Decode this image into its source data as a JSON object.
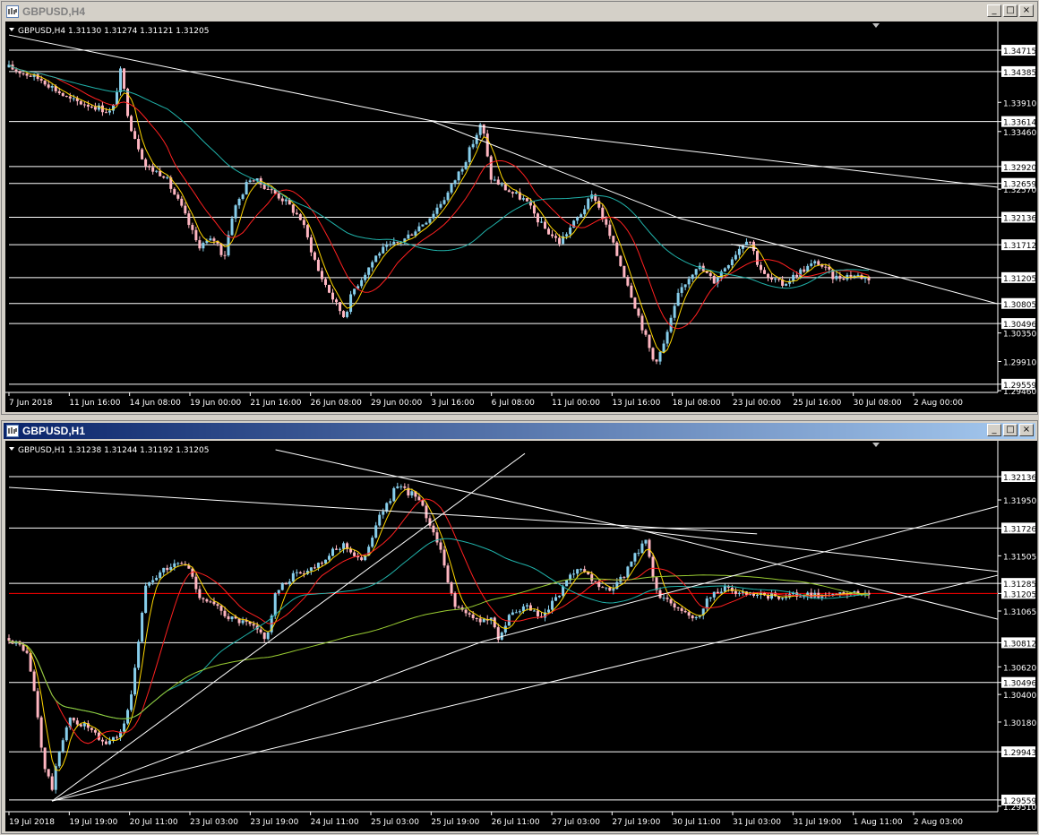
{
  "colors": {
    "background": "#000000",
    "bull_candle": "#87ceeb",
    "bear_candle": "#ffb6c1",
    "ma_fast": "#ffd700",
    "ma_mid": "#ff2020",
    "ma_slow": "#20b2aa",
    "ma_slowest": "#9acd32",
    "hline": "#ffffff",
    "text": "#ffffff",
    "current_price": "#ff0000"
  },
  "windows": [
    {
      "title": "GBPUSD,H4",
      "state": "inactive",
      "info": "GBPUSD,H4  1.31130 1.31274 1.31121 1.31205",
      "price_range": [
        1.2946,
        1.3502
      ],
      "price_ticks": [
        "1.34715",
        "1.34385",
        "1.33910",
        "1.33614",
        "1.33460",
        "1.32920",
        "1.32659",
        "1.32570",
        "1.32136",
        "1.31712",
        "1.31205",
        "1.30805",
        "1.30496",
        "1.30350",
        "1.29910",
        "1.29559",
        "1.29460"
      ],
      "boxed_levels": [
        "1.34715",
        "1.34385",
        "1.33614",
        "1.32920",
        "1.32659",
        "1.32136",
        "1.31712",
        "1.31205",
        "1.30805",
        "1.30496",
        "1.29559"
      ],
      "time_labels": [
        "7 Jun 2018",
        "11 Jun 16:00",
        "14 Jun 08:00",
        "19 Jun 00:00",
        "21 Jun 16:00",
        "26 Jun 08:00",
        "29 Jun 00:00",
        "3 Jul 16:00",
        "6 Jul 08:00",
        "11 Jul 00:00",
        "13 Jul 16:00",
        "18 Jul 08:00",
        "23 Jul 00:00",
        "25 Jul 16:00",
        "30 Jul 08:00",
        "2 Aug 00:00"
      ],
      "path": [
        [
          0,
          1.3445
        ],
        [
          0.04,
          1.3425
        ],
        [
          0.07,
          1.3395
        ],
        [
          0.1,
          1.3385
        ],
        [
          0.12,
          1.3375
        ],
        [
          0.13,
          1.344
        ],
        [
          0.14,
          1.336
        ],
        [
          0.16,
          1.329
        ],
        [
          0.18,
          1.328
        ],
        [
          0.2,
          1.323
        ],
        [
          0.22,
          1.317
        ],
        [
          0.24,
          1.318
        ],
        [
          0.25,
          1.315
        ],
        [
          0.26,
          1.322
        ],
        [
          0.28,
          1.3275
        ],
        [
          0.3,
          1.326
        ],
        [
          0.32,
          1.324
        ],
        [
          0.34,
          1.321
        ],
        [
          0.36,
          1.313
        ],
        [
          0.38,
          1.308
        ],
        [
          0.39,
          1.306
        ],
        [
          0.4,
          1.31
        ],
        [
          0.43,
          1.316
        ],
        [
          0.46,
          1.318
        ],
        [
          0.49,
          1.3215
        ],
        [
          0.51,
          1.325
        ],
        [
          0.53,
          1.33
        ],
        [
          0.55,
          1.336
        ],
        [
          0.56,
          1.3275
        ],
        [
          0.58,
          1.3255
        ],
        [
          0.6,
          1.324
        ],
        [
          0.62,
          1.32
        ],
        [
          0.64,
          1.3175
        ],
        [
          0.66,
          1.321
        ],
        [
          0.68,
          1.325
        ],
        [
          0.7,
          1.318
        ],
        [
          0.72,
          1.311
        ],
        [
          0.74,
          1.303
        ],
        [
          0.75,
          1.299
        ],
        [
          0.76,
          1.301
        ],
        [
          0.78,
          1.31
        ],
        [
          0.8,
          1.314
        ],
        [
          0.82,
          1.3115
        ],
        [
          0.84,
          1.315
        ],
        [
          0.86,
          1.3185
        ],
        [
          0.87,
          1.3145
        ],
        [
          0.88,
          1.312
        ],
        [
          0.9,
          1.311
        ],
        [
          0.92,
          1.313
        ],
        [
          0.94,
          1.3145
        ],
        [
          0.96,
          1.312
        ],
        [
          0.98,
          1.3125
        ],
        [
          1,
          1.312
        ]
      ],
      "trendlines": [
        [
          0,
          1.3495,
          0.49,
          1.3363
        ],
        [
          0.49,
          1.3363,
          1,
          1.326
        ],
        [
          0.49,
          1.3363,
          0.78,
          1.3212
        ],
        [
          0.78,
          1.3212,
          1,
          1.308
        ],
        [
          0.84,
          1.3172,
          0.87,
          1.3165
        ]
      ]
    },
    {
      "title": "GBPUSD,H1",
      "state": "active",
      "info": "GBPUSD,H1  1.31238 1.31244 1.31192 1.31205",
      "price_range": [
        1.2948,
        1.3235
      ],
      "price_ticks": [
        "1.32136",
        "1.31950",
        "1.31726",
        "1.31505",
        "1.31285",
        "1.31205",
        "1.31065",
        "1.30812",
        "1.30620",
        "1.30496",
        "1.30400",
        "1.30180",
        "1.29943",
        "1.29559",
        "1.29510"
      ],
      "boxed_levels": [
        "1.32136",
        "1.31726",
        "1.31285",
        "1.30812",
        "1.30496",
        "1.29943",
        "1.29559"
      ],
      "current_price": "1.31205",
      "time_labels": [
        "19 Jul 2018",
        "19 Jul 19:00",
        "20 Jul 11:00",
        "23 Jul 03:00",
        "23 Jul 19:00",
        "24 Jul 11:00",
        "25 Jul 03:00",
        "25 Jul 19:00",
        "26 Jul 11:00",
        "27 Jul 03:00",
        "27 Jul 19:00",
        "30 Jul 11:00",
        "31 Jul 03:00",
        "31 Jul 19:00",
        "1 Aug 11:00",
        "2 Aug 03:00"
      ],
      "path": [
        [
          0,
          1.3085
        ],
        [
          0.02,
          1.3075
        ],
        [
          0.03,
          1.304
        ],
        [
          0.04,
          1.2985
        ],
        [
          0.05,
          1.2965
        ],
        [
          0.06,
          1.3
        ],
        [
          0.07,
          1.302
        ],
        [
          0.09,
          1.3015
        ],
        [
          0.11,
          1.3
        ],
        [
          0.13,
          1.301
        ],
        [
          0.14,
          1.303
        ],
        [
          0.15,
          1.308
        ],
        [
          0.16,
          1.313
        ],
        [
          0.18,
          1.314
        ],
        [
          0.2,
          1.3145
        ],
        [
          0.21,
          1.314
        ],
        [
          0.22,
          1.312
        ],
        [
          0.24,
          1.311
        ],
        [
          0.26,
          1.31
        ],
        [
          0.28,
          1.3095
        ],
        [
          0.3,
          1.3085
        ],
        [
          0.31,
          1.312
        ],
        [
          0.33,
          1.3135
        ],
        [
          0.35,
          1.314
        ],
        [
          0.37,
          1.315
        ],
        [
          0.39,
          1.316
        ],
        [
          0.41,
          1.3145
        ],
        [
          0.43,
          1.318
        ],
        [
          0.45,
          1.3205
        ],
        [
          0.47,
          1.32
        ],
        [
          0.48,
          1.319
        ],
        [
          0.5,
          1.316
        ],
        [
          0.51,
          1.313
        ],
        [
          0.52,
          1.311
        ],
        [
          0.54,
          1.31
        ],
        [
          0.56,
          1.31
        ],
        [
          0.57,
          1.3085
        ],
        [
          0.58,
          1.31
        ],
        [
          0.6,
          1.311
        ],
        [
          0.62,
          1.31
        ],
        [
          0.64,
          1.312
        ],
        [
          0.66,
          1.314
        ],
        [
          0.68,
          1.313
        ],
        [
          0.7,
          1.312
        ],
        [
          0.72,
          1.314
        ],
        [
          0.74,
          1.3165
        ],
        [
          0.75,
          1.313
        ],
        [
          0.76,
          1.3115
        ],
        [
          0.78,
          1.311
        ],
        [
          0.8,
          1.31
        ],
        [
          0.81,
          1.3115
        ],
        [
          0.83,
          1.3125
        ],
        [
          0.85,
          1.312
        ],
        [
          0.87,
          1.3118
        ],
        [
          1,
          1.312
        ]
      ],
      "trendlines": [
        [
          0.31,
          1.3235,
          0.74,
          1.317
        ],
        [
          0.74,
          1.317,
          1,
          1.3138
        ],
        [
          0.74,
          1.317,
          1,
          1.31
        ],
        [
          0.05,
          1.2955,
          0.6,
          1.3232
        ],
        [
          0.05,
          1.2955,
          0.55,
          1.3082
        ],
        [
          0.55,
          1.3082,
          1,
          1.319
        ],
        [
          0.05,
          1.2955,
          1,
          1.3135
        ],
        [
          0,
          1.3205,
          0.87,
          1.3168
        ]
      ]
    }
  ]
}
